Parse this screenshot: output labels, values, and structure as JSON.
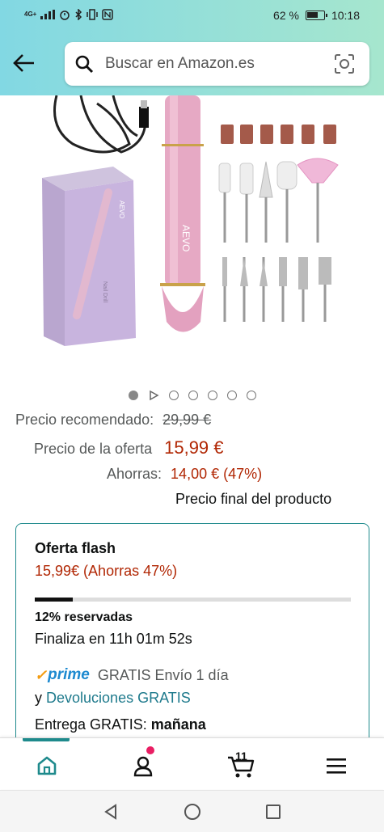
{
  "status_bar": {
    "network": "4G+",
    "battery_pct": "62 %",
    "time": "10:18"
  },
  "header": {
    "back_icon": "arrow-left-icon",
    "search": {
      "placeholder": "Buscar en Amazon.es",
      "icon": "search-icon",
      "camera_icon": "camera-scan-icon"
    }
  },
  "product": {
    "brand_on_device": "AEVO",
    "box_label": "Nail Drill",
    "image_count": 7,
    "active_index": 0
  },
  "pricing": {
    "list_label": "Precio recomendado:",
    "list_price": "29,99 €",
    "deal_label": "Precio de la oferta",
    "deal_price": "15,99 €",
    "save_label": "Ahorras:",
    "save_value": "14,00 € (47%)",
    "final_note": "Precio final del producto"
  },
  "flash": {
    "title": "Oferta flash",
    "deal_text": "15,99€ (Ahorras 47%)",
    "claimed_fraction": 0.12,
    "reserved_text": "12% reservadas",
    "ends_text": "Finaliza en 11h 01m 52s",
    "prime_label": "prime",
    "shipping_text": "GRATIS Envío 1 día",
    "returns_prefix": "y",
    "returns_link": "Devoluciones GRATIS",
    "delivery_prefix": "Entrega GRATIS:",
    "delivery_day": "mañana"
  },
  "bottom_nav": {
    "cart_count": "11",
    "items": [
      "home-icon",
      "account-icon",
      "cart-icon",
      "menu-icon"
    ]
  },
  "colors": {
    "accent": "#1e8a8c",
    "price_red": "#b12704",
    "prime_blue": "#1e8ad0"
  }
}
